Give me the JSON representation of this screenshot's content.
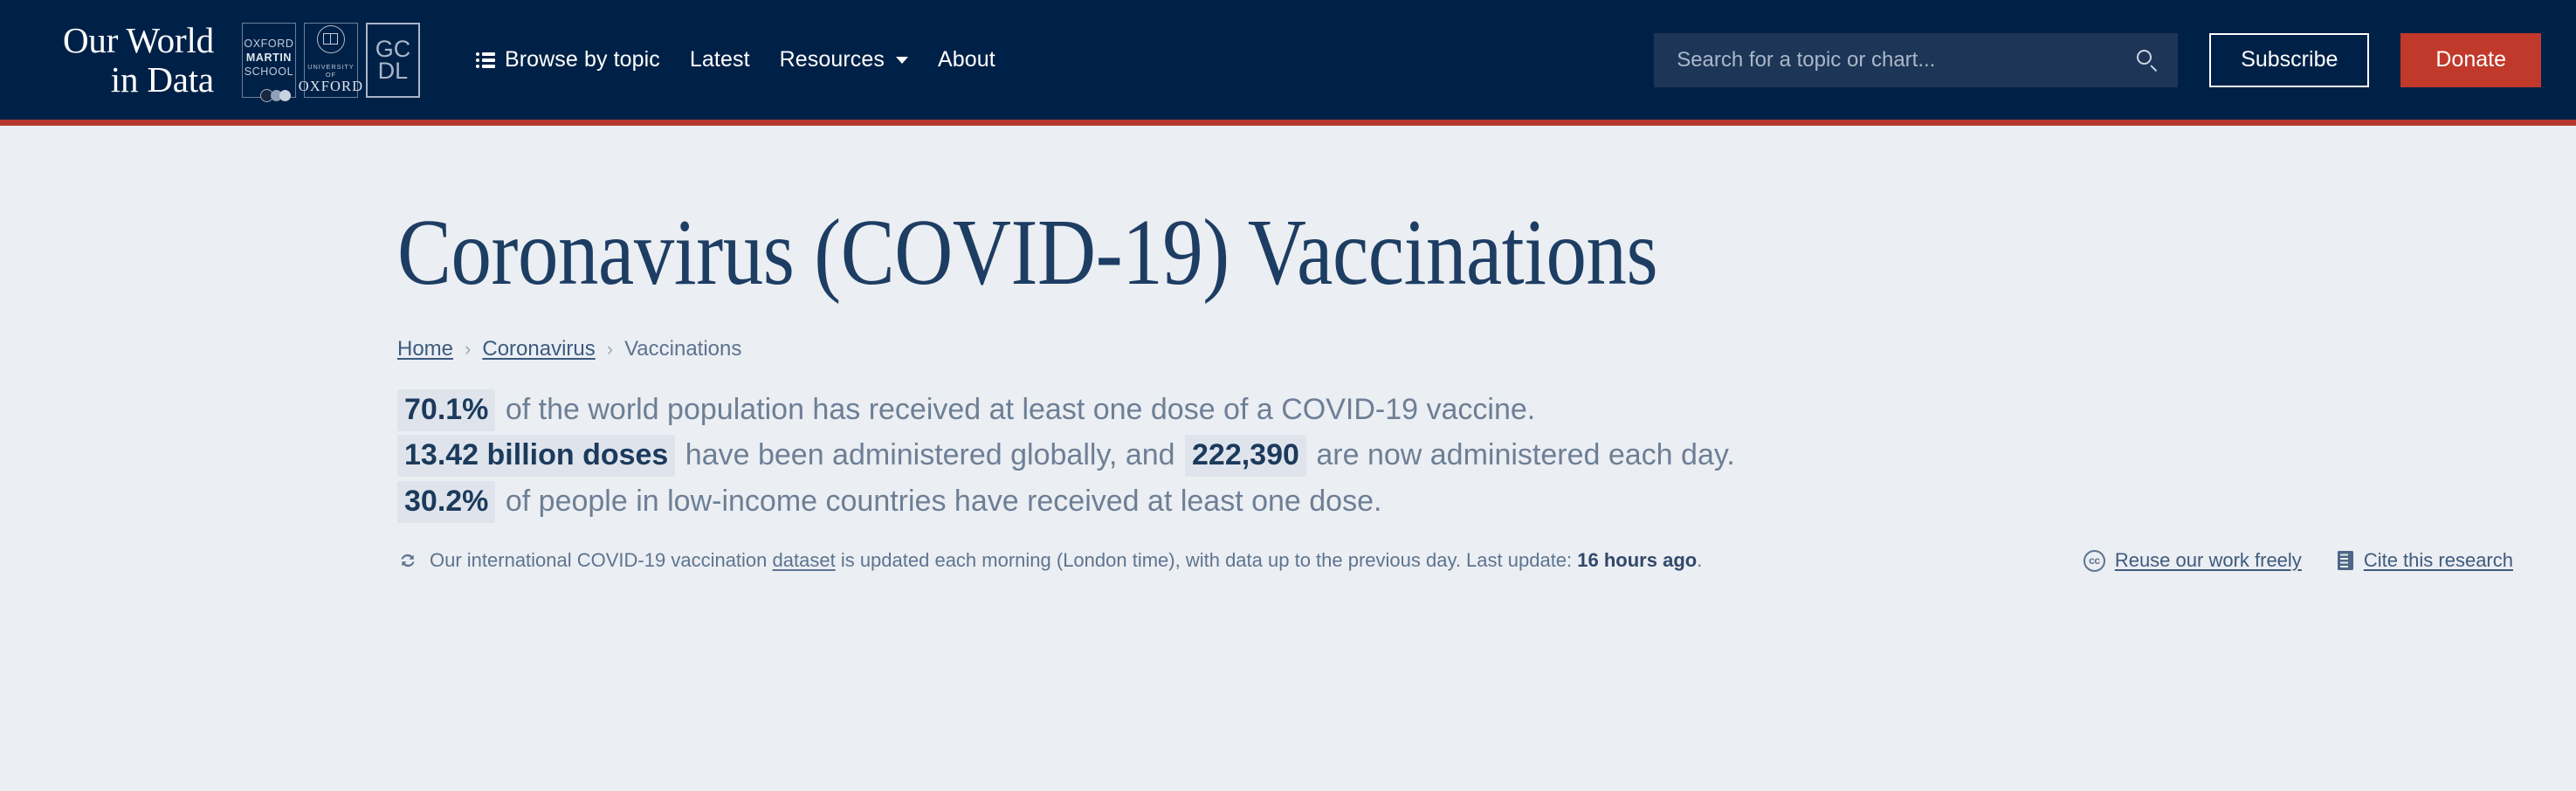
{
  "header": {
    "brand": {
      "line1": "Our World",
      "line2": "in Data"
    },
    "partner_logos": [
      {
        "name": "oxford-martin-school",
        "lines": [
          "OXFORD",
          "MARTIN",
          "SCHOOL"
        ]
      },
      {
        "name": "university-of-oxford",
        "line_small": "UNIVERSITY OF",
        "line_main": "OXFORD"
      },
      {
        "name": "gcdl",
        "line1": "GC",
        "line2": "DL"
      }
    ],
    "nav": [
      {
        "label": "Browse by topic",
        "icon": "list-icon",
        "has_caret": false
      },
      {
        "label": "Latest",
        "icon": null,
        "has_caret": false
      },
      {
        "label": "Resources",
        "icon": null,
        "has_caret": true
      },
      {
        "label": "About",
        "icon": null,
        "has_caret": false
      }
    ],
    "search": {
      "placeholder": "Search for a topic or chart...",
      "value": "",
      "icon": "search-icon"
    },
    "subscribe_label": "Subscribe",
    "donate_label": "Donate",
    "colors": {
      "background": "#002147",
      "accent_bar": "#b5392e",
      "donate": "#c0392b",
      "search_field": "#1d3557"
    }
  },
  "main": {
    "title": "Coronavirus (COVID-19) Vaccinations",
    "breadcrumb": [
      {
        "label": "Home",
        "link": true
      },
      {
        "label": "Coronavirus",
        "link": true
      },
      {
        "label": "Vaccinations",
        "link": false
      }
    ],
    "breadcrumb_separator": "›",
    "stats": [
      {
        "highlight": "70.1%",
        "rest": " of the world population has received at least one dose of a COVID-19 vaccine."
      },
      {
        "highlight": "13.42 billion doses",
        "mid": " have been administered globally, and ",
        "highlight2": "222,390",
        "rest": " are now administered each day."
      },
      {
        "highlight": "30.2%",
        "rest": " of people in low-income countries have received at least one dose."
      }
    ],
    "update": {
      "icon": "sync-icon",
      "text_before_link": "Our international COVID-19 vaccination ",
      "link": "dataset",
      "text_after_link": " is updated each morning (London time), with data up to the previous day. Last update: ",
      "last_update": "16 hours ago",
      "trailing": "."
    },
    "footer_links": [
      {
        "icon": "creative-commons-icon",
        "glyph": "cc",
        "label": "Reuse our work freely"
      },
      {
        "icon": "book-icon",
        "glyph": "",
        "label": "Cite this research"
      }
    ],
    "colors": {
      "page_background": "#ebeef2",
      "title": "#1d3d63",
      "highlight_bg": "#dfe4ec",
      "highlight_text": "#1b3a5c",
      "body_text": "#6d7f96"
    }
  }
}
